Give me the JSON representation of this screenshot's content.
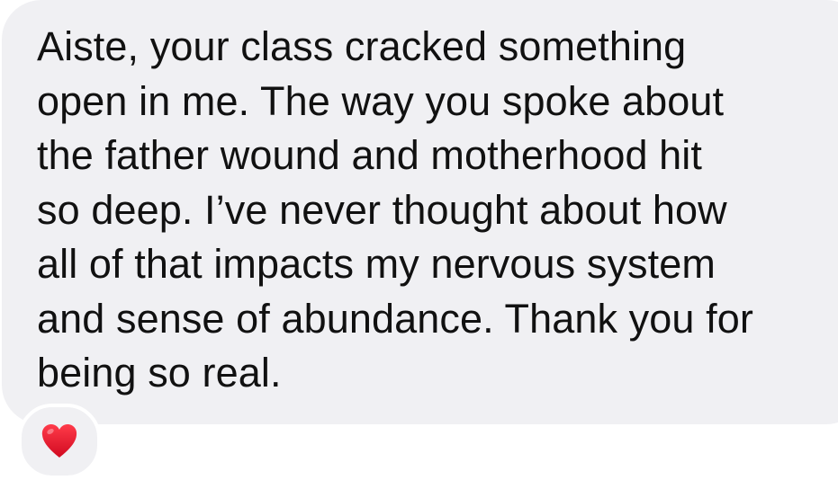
{
  "message": {
    "lines": [
      "Aiste, your class cracked something",
      "open in me. The way you spoke about",
      "the father wound and motherhood hit",
      "so deep. I’ve never thought about how",
      "all of that impacts my nervous system",
      "and sense of abundance. Thank you for",
      "being so real."
    ]
  },
  "reaction": {
    "icon": "red-heart-icon",
    "color": "#e8112d"
  },
  "colors": {
    "bubble_background": "#f0f0f3",
    "text": "#111111"
  }
}
